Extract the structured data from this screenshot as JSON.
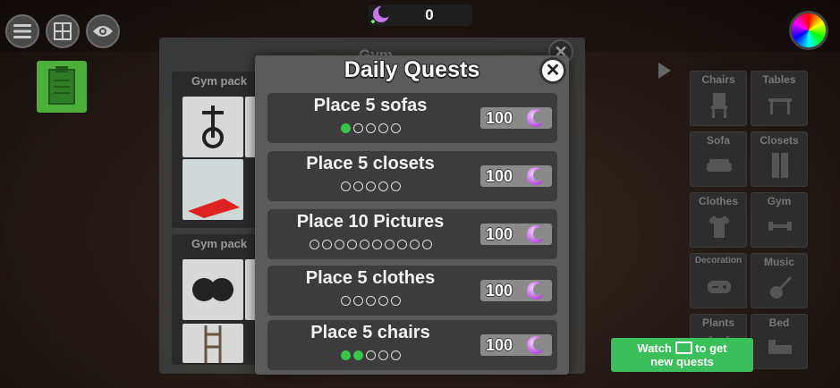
{
  "hud": {
    "currency_value": "0"
  },
  "background_panel": {
    "title": "Gym",
    "section1_label": "Gym pack",
    "section2_label": "Gym pack"
  },
  "categories": [
    {
      "label": "Chairs",
      "icon": "chair-icon"
    },
    {
      "label": "Tables",
      "icon": "table-icon"
    },
    {
      "label": "Sofa",
      "icon": "sofa-icon"
    },
    {
      "label": "Closets",
      "icon": "closet-icon"
    },
    {
      "label": "Clothes",
      "icon": "shirt-icon"
    },
    {
      "label": "Gym",
      "icon": "dumbbell-icon"
    },
    {
      "label": "Decoration",
      "icon": "gamepad-icon"
    },
    {
      "label": "Music",
      "icon": "guitar-icon"
    },
    {
      "label": "Plants",
      "icon": "plant-icon"
    },
    {
      "label": "Bed",
      "icon": "bed-icon"
    }
  ],
  "modal": {
    "title": "Daily Quests",
    "quests": [
      {
        "title": "Place 5 sofas",
        "total": 5,
        "done": 1,
        "reward": "100"
      },
      {
        "title": "Place 5 closets",
        "total": 5,
        "done": 0,
        "reward": "100"
      },
      {
        "title": "Place 10 Pictures",
        "total": 10,
        "done": 0,
        "reward": "100"
      },
      {
        "title": "Place 5 clothes",
        "total": 5,
        "done": 0,
        "reward": "100"
      },
      {
        "title": "Place 5 chairs",
        "total": 5,
        "done": 2,
        "reward": "100"
      }
    ]
  },
  "watch_button": {
    "line1_pre": "Watch",
    "line1_post": "to get",
    "line2": "new quests"
  },
  "colors": {
    "accent_green": "#3bbf5a",
    "progress_done": "#38c548",
    "currency_purple": "#b44be0"
  }
}
